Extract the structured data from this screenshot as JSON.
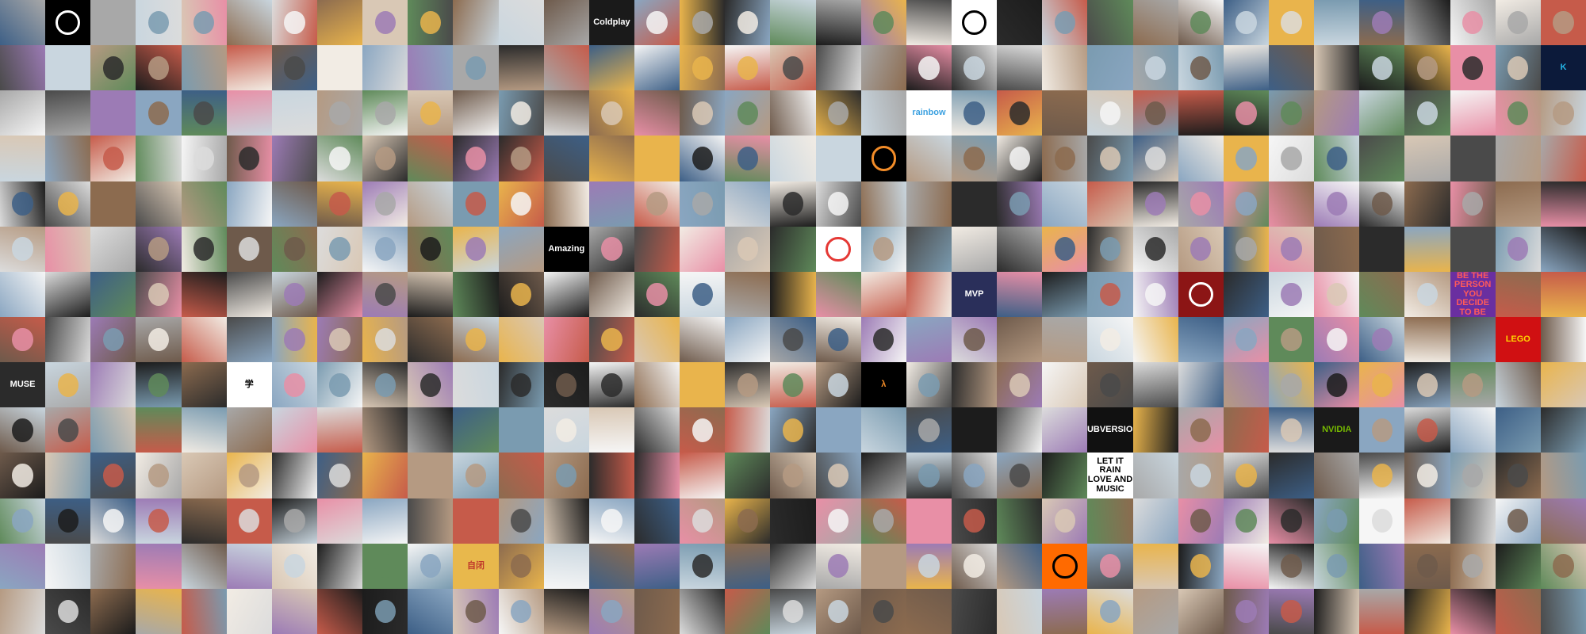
{
  "mosaic": {
    "columns": 35,
    "rows": 14,
    "palette": [
      "#2b2b2b",
      "#6e5a4b",
      "#b59a82",
      "#d9c8b5",
      "#f2ece4",
      "#8aa6c1",
      "#3d5f86",
      "#c65b4a",
      "#e9b44c",
      "#5f8a5a",
      "#9c7bb5",
      "#e88fa6",
      "#1c1c1c",
      "#a8a8a8",
      "#dcdcdc",
      "#7a9bb0",
      "#c9d6df",
      "#8c6b4f",
      "#f6f6f6",
      "#4a4a4a"
    ],
    "special_tiles": [
      {
        "row": 0,
        "col": 1,
        "kind": "logo-icon",
        "label": "",
        "bg": "#000000",
        "fg": "#ffffff"
      },
      {
        "row": 0,
        "col": 13,
        "kind": "text",
        "label": "Coldplay",
        "bg": "#1a1a1a",
        "fg": "#ffffff"
      },
      {
        "row": 0,
        "col": 21,
        "kind": "logo-icon",
        "label": "",
        "bg": "#ffffff",
        "fg": "#000000"
      },
      {
        "row": 1,
        "col": 34,
        "kind": "logo-icon",
        "label": "K",
        "bg": "#0c1a3a",
        "fg": "#24b5e6"
      },
      {
        "row": 2,
        "col": 20,
        "kind": "text",
        "label": "rainbow",
        "bg": "#ffffff",
        "fg": "#3aa0e0"
      },
      {
        "row": 3,
        "col": 19,
        "kind": "logo-icon",
        "label": "",
        "bg": "#000000",
        "fg": "#f28c28"
      },
      {
        "row": 5,
        "col": 12,
        "kind": "text",
        "label": "Amazing",
        "bg": "#000000",
        "fg": "#ffffff"
      },
      {
        "row": 5,
        "col": 18,
        "kind": "logo-icon",
        "label": "",
        "bg": "#ffffff",
        "fg": "#e53935"
      },
      {
        "row": 6,
        "col": 21,
        "kind": "text",
        "label": "MVP",
        "bg": "#2a2f5a",
        "fg": "#ffffff"
      },
      {
        "row": 6,
        "col": 26,
        "kind": "logo-icon",
        "label": "",
        "bg": "#8c1515",
        "fg": "#ffffff"
      },
      {
        "row": 6,
        "col": 32,
        "kind": "text",
        "label": "BE THE PERSON YOU DECIDE TO BE",
        "bg": "#6a2fa0",
        "fg": "#ff5a5a"
      },
      {
        "row": 7,
        "col": 33,
        "kind": "text",
        "label": "LEGO",
        "bg": "#d01012",
        "fg": "#ffd500"
      },
      {
        "row": 8,
        "col": 0,
        "kind": "text",
        "label": "MUSE",
        "bg": "#2b2b2b",
        "fg": "#ffffff"
      },
      {
        "row": 8,
        "col": 5,
        "kind": "text",
        "label": "学",
        "bg": "#ffffff",
        "fg": "#000000"
      },
      {
        "row": 8,
        "col": 19,
        "kind": "logo-icon",
        "label": "λ",
        "bg": "#000000",
        "fg": "#f28c28"
      },
      {
        "row": 9,
        "col": 24,
        "kind": "text",
        "label": "SUBVERSION",
        "bg": "#111111",
        "fg": "#ffffff"
      },
      {
        "row": 9,
        "col": 29,
        "kind": "text",
        "label": "NVIDIA",
        "bg": "#1a1a1a",
        "fg": "#76b900"
      },
      {
        "row": 10,
        "col": 24,
        "kind": "text",
        "label": "LET IT RAIN\nLOVE AND\nMUSIC",
        "bg": "#ffffff",
        "fg": "#000000"
      },
      {
        "row": 12,
        "col": 10,
        "kind": "text",
        "label": "自闭",
        "bg": "#e8b84c",
        "fg": "#c0392b"
      },
      {
        "row": 12,
        "col": 23,
        "kind": "logo-icon",
        "label": "",
        "bg": "#ff6a00",
        "fg": "#000000"
      }
    ]
  }
}
